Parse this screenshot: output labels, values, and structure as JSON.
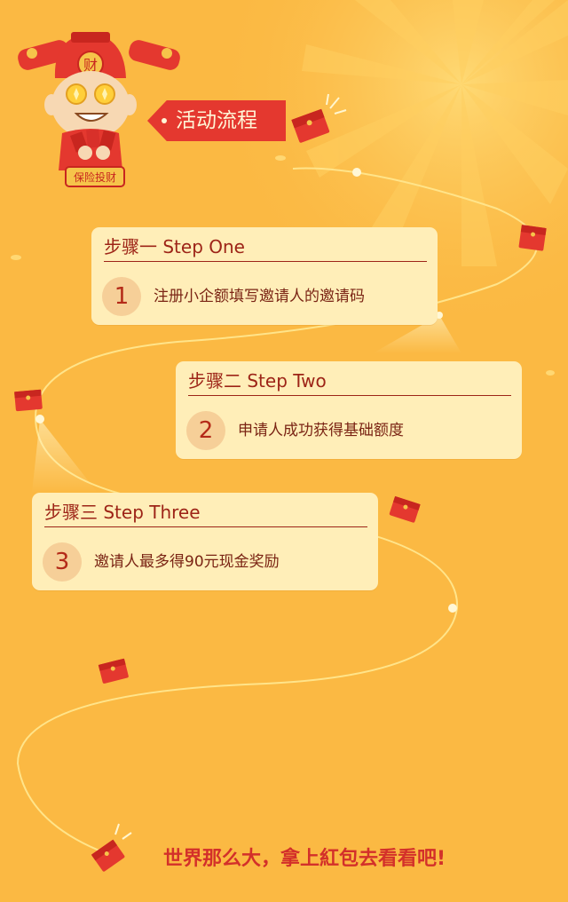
{
  "title": "活动流程",
  "mascot": {
    "hat_char": "财",
    "banner_text": "保险投财"
  },
  "steps": [
    {
      "heading": "步骤一 Step One",
      "number": "1",
      "description": "注册小企额填写邀请人的邀请码"
    },
    {
      "heading": "步骤二 Step Two",
      "number": "2",
      "description": "申请人成功获得基础额度"
    },
    {
      "heading": "步骤三 Step Three",
      "number": "3",
      "description": "邀请人最多得90元现金奖励"
    }
  ],
  "footer": "世界那么大，拿上紅包去看看吧!",
  "icons": [
    "red-envelope-icon",
    "sparkle-icon",
    "spotlight-beam"
  ],
  "colors": {
    "background": "#fbb943",
    "card": "#ffeeb8",
    "accent_red": "#e4382f",
    "text_dark_red": "#9d2417",
    "number_circle": "#f6cf98"
  }
}
